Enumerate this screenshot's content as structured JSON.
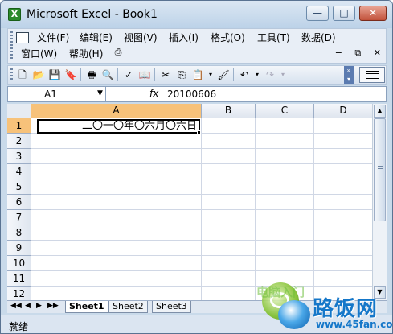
{
  "window": {
    "app_icon": "X",
    "title": "Microsoft Excel - Book1",
    "buttons": {
      "minimize": "—",
      "maximize": "□",
      "close": "✕"
    }
  },
  "menubar": {
    "items": [
      "文件(F)",
      "编辑(E)",
      "视图(V)",
      "插入(I)",
      "格式(O)",
      "工具(T)",
      "数据(D)",
      "窗口(W)",
      "帮助(H)"
    ],
    "mdi_buttons": [
      "−",
      "⧉",
      "✕"
    ]
  },
  "toolbar": {
    "icons": [
      "new-icon",
      "open-icon",
      "save-icon",
      "permission-icon",
      "print-icon",
      "print-preview-icon",
      "spelling-icon",
      "research-icon",
      "cut-icon",
      "copy-icon",
      "paste-icon",
      "format-painter-icon",
      "undo-icon",
      "redo-icon",
      "align-icon"
    ]
  },
  "formula_bar": {
    "name_box": "A1",
    "fx": "fx",
    "formula": "20100606"
  },
  "grid": {
    "columns": [
      "A",
      "B",
      "C",
      "D"
    ],
    "selected_column": "A",
    "rows": [
      "1",
      "2",
      "3",
      "4",
      "5",
      "6",
      "7",
      "8",
      "9",
      "10",
      "11",
      "12"
    ],
    "selected_row": "1",
    "active_cell_value": "二〇一〇年〇六月〇六日"
  },
  "sheets": {
    "tabs": [
      "Sheet1",
      "Sheet2",
      "Sheet3"
    ],
    "active": "Sheet1",
    "nav": [
      "◀◀",
      "◀",
      "▶",
      "▶▶"
    ]
  },
  "status": {
    "text": "就绪"
  },
  "watermark": {
    "brand": "路饭网",
    "url": "www.45fan.com",
    "faint": "电脑入门"
  }
}
